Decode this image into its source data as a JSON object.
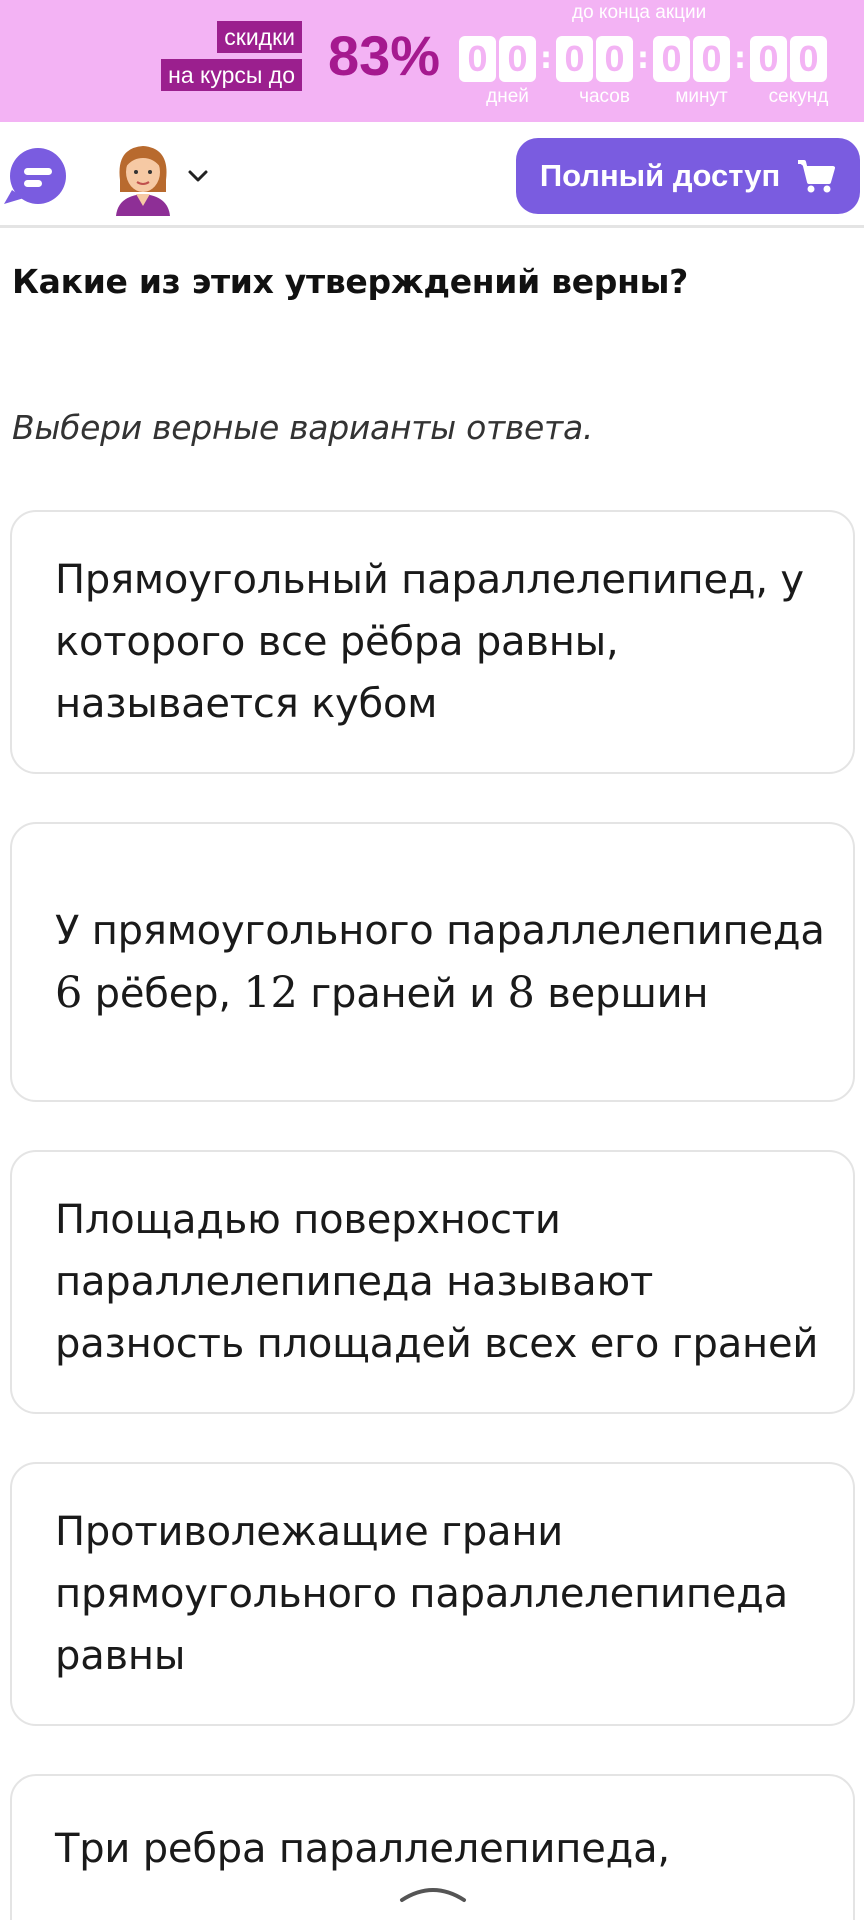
{
  "promo": {
    "tag_line1": "скидки",
    "tag_line2": "на курсы до",
    "percent": "83%",
    "countdown_caption": "до конца акции",
    "countdown": [
      {
        "digits": [
          "0",
          "0"
        ],
        "label": "дней"
      },
      {
        "digits": [
          "0",
          "0"
        ],
        "label": "часов"
      },
      {
        "digits": [
          "0",
          "0"
        ],
        "label": "минут"
      },
      {
        "digits": [
          "0",
          "0"
        ],
        "label": "секунд"
      }
    ],
    "separator": ":"
  },
  "header": {
    "full_access_label": "Полный доступ"
  },
  "task": {
    "question": "Какие из этих утверждений верны?",
    "instruction": "Выбери верные варианты ответа.",
    "options": [
      {
        "text": "Прямоугольный параллелепипед, у которого все рёбра равны, называется кубом"
      },
      {
        "parts": [
          "У прямоугольного параллелепипеда ",
          "6",
          " рёбер, ",
          "12",
          " граней и ",
          "8",
          " вершин"
        ]
      },
      {
        "text": "Площадью поверхности параллелепипеда называют разность площадей всех его граней"
      },
      {
        "text": "Противолежащие грани прямоугольного параллелепипеда равны"
      },
      {
        "text": "Три ребра параллелепипеда,"
      }
    ]
  },
  "colors": {
    "promo_bg": "#f3b3f4",
    "promo_tag": "#9b1f8e",
    "promo_percent": "#a5198f",
    "accent_button": "#7a5ce0",
    "chat_icon": "#7a5ce0",
    "card_border": "#e4e4e4"
  },
  "icons": {
    "chat": "chat-bubble-icon",
    "avatar": "teacher-avatar",
    "chevron": "chevron-down-icon",
    "cart": "cart-icon",
    "scroll": "chevron-up-icon"
  }
}
